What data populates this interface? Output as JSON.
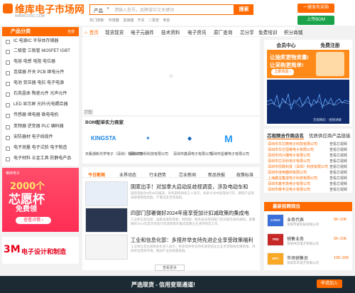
{
  "header": {
    "logo_text": "维库电子市场网",
    "logo_sub": "WWW.DZSC.COM",
    "search_category": "产品",
    "search_placeholder": "请输入型号，品牌或中文关键词",
    "search_button": "搜索",
    "hot_words": [
      "热门搜索:",
      "传感器",
      "连接器",
      "开关",
      "二极管",
      "电容"
    ],
    "buy_button": "一键发布采购",
    "bom_button": "上传BOM"
  },
  "sidebar": {
    "title": "产品分类",
    "more": "全部",
    "items": [
      "IC 电源IC 半导体存储器",
      "二极管 三极管 MOSFET IGBT",
      "电容 电感 电阻 电位器",
      "连接器 开关 PCB 继电元件",
      "电池 变压器 电抗 电子电源",
      "石英晶体 陶瓷元件 光声元件",
      "LED 显示屏 光纤/光电耦合器",
      "传感器 继电器 微电电机",
      "变频器 逆变器 PLC 编码器",
      "安防器材 电子线缆件",
      "电子测量 电子试验 电子制造",
      "电子材料 五金工具 防静电产品"
    ]
  },
  "left_ads": {
    "promo_logo": "维库电子",
    "promo_line1": "2000个",
    "promo_line2": "芯愿杯",
    "promo_line3": "免费领",
    "promo_button": "查看详情 ›",
    "brand_logo": "3M",
    "brand_text": "电子设计和制造"
  },
  "nav": {
    "items": [
      "☆ 首页",
      "现货现货",
      "电子元器件",
      "技术资料",
      "电子资讯",
      "原厂查询",
      "芯分享",
      "免费培训",
      "积分商城"
    ]
  },
  "banner": {
    "spinner": "⁘",
    "tag": "广告"
  },
  "bom": {
    "title": "BOM配单实力商家",
    "vendors": [
      {
        "logo": "KINGSTA",
        "name": "天籁通新光学电子（深圳）有限公司",
        "color": "#1e88e5"
      },
      {
        "logo": "✦",
        "name": "深圳市精科科技有限公司",
        "color": "#1976d2"
      },
      {
        "logo": "◆",
        "name": "深圳市鑫源电子有限公司",
        "color": "#1565c0"
      },
      {
        "logo": "M",
        "name": "深圳市星耀电子有限公司",
        "color": "#2196f3"
      }
    ]
  },
  "member": {
    "tab1": "会员中心",
    "tab2": "免费注册",
    "ad_line1": "让抽奖更物资量!",
    "ad_line2": "让采购更简单!",
    "ad_button": "立即体验 ›",
    "wave_text": "无限精彩 · 视频讲解"
  },
  "ranking": {
    "tab1": "芯视频合作商店名",
    "tab2": "优质供应商产品链接",
    "rows": [
      {
        "name": "深圳市华芯微电子科技有限公司",
        "action": "查看芯视频"
      },
      {
        "name": "深圳市华芯恒泰电子有限公司",
        "action": "查看芯视频"
      },
      {
        "name": "深圳市鸿兴捷电子有限公司",
        "action": "查看芯视频"
      },
      {
        "name": "深圳市芯沃科电子有限公司",
        "action": "查看芯视频"
      },
      {
        "name": "深圳市优联科技（深圳）科技有限公司",
        "action": "查看芯视频"
      },
      {
        "name": "深圳市佳电器材有限公司",
        "action": "查看芯视频"
      },
      {
        "name": "上海鑫宝集成电子科技有限公司",
        "action": "查看芯视频"
      },
      {
        "name": "深圳市鑫宇高电子有限公司",
        "action": "查看芯视频"
      },
      {
        "name": "深圳市泰丰达电子有限公司",
        "action": "查看芯视频"
      }
    ]
  },
  "jobs": {
    "title": "最新招聘岗位",
    "items": [
      {
        "logo": "LOGO",
        "name": "业务代表",
        "sub": "深圳市某科技有限公司",
        "salary": "5K-10K",
        "color": "#3a6ed8"
      },
      {
        "logo": "TRD",
        "name": "销售业务",
        "sub": "深圳中芯电子有限公司",
        "salary": "5K-10K",
        "color": "#c62828"
      },
      {
        "logo": "HFC",
        "name": "市场销售员",
        "sub": "深圳华丰电子有限公司",
        "salary": "10K-20K",
        "color": "#f9a825"
      }
    ]
  },
  "news": {
    "tabs": [
      "今日新闻",
      "业界动态",
      "行业趋势",
      "芯业新闻",
      "新品快报",
      "政策标准"
    ],
    "items": [
      {
        "title": "国家出手！对加拿大启动反歧视调查，涉及电动车和",
        "desc": "国际电视台9月26日报道，商务部新闻发言人表示，加拿大对中国电动汽车、钢铝产品等采取限制性措施，严重违反世贸规则。"
      },
      {
        "title": "四部门部署做好2024年度享受加计扣减政策的集成电",
        "desc": "工业和信息化部、国家发展改革委、财政部、税务总局等四部门近日联合发布通知，部署做好2024年度享受加计扣减政策的集成电路企业清单制定工作。"
      },
      {
        "title": "工业和信息化部：多措并举支持先进企业享受政策福利",
        "desc": "工业和信息化部相关负责人表示，将多措并举支持先进制造业企业享受税收优惠政策，持续优化营商环境，推动产业高质量发展。"
      }
    ],
    "more_button": "查看更多"
  },
  "bottom": {
    "text": "严选现货 - 信用变现通道!",
    "button": "申请加入"
  }
}
